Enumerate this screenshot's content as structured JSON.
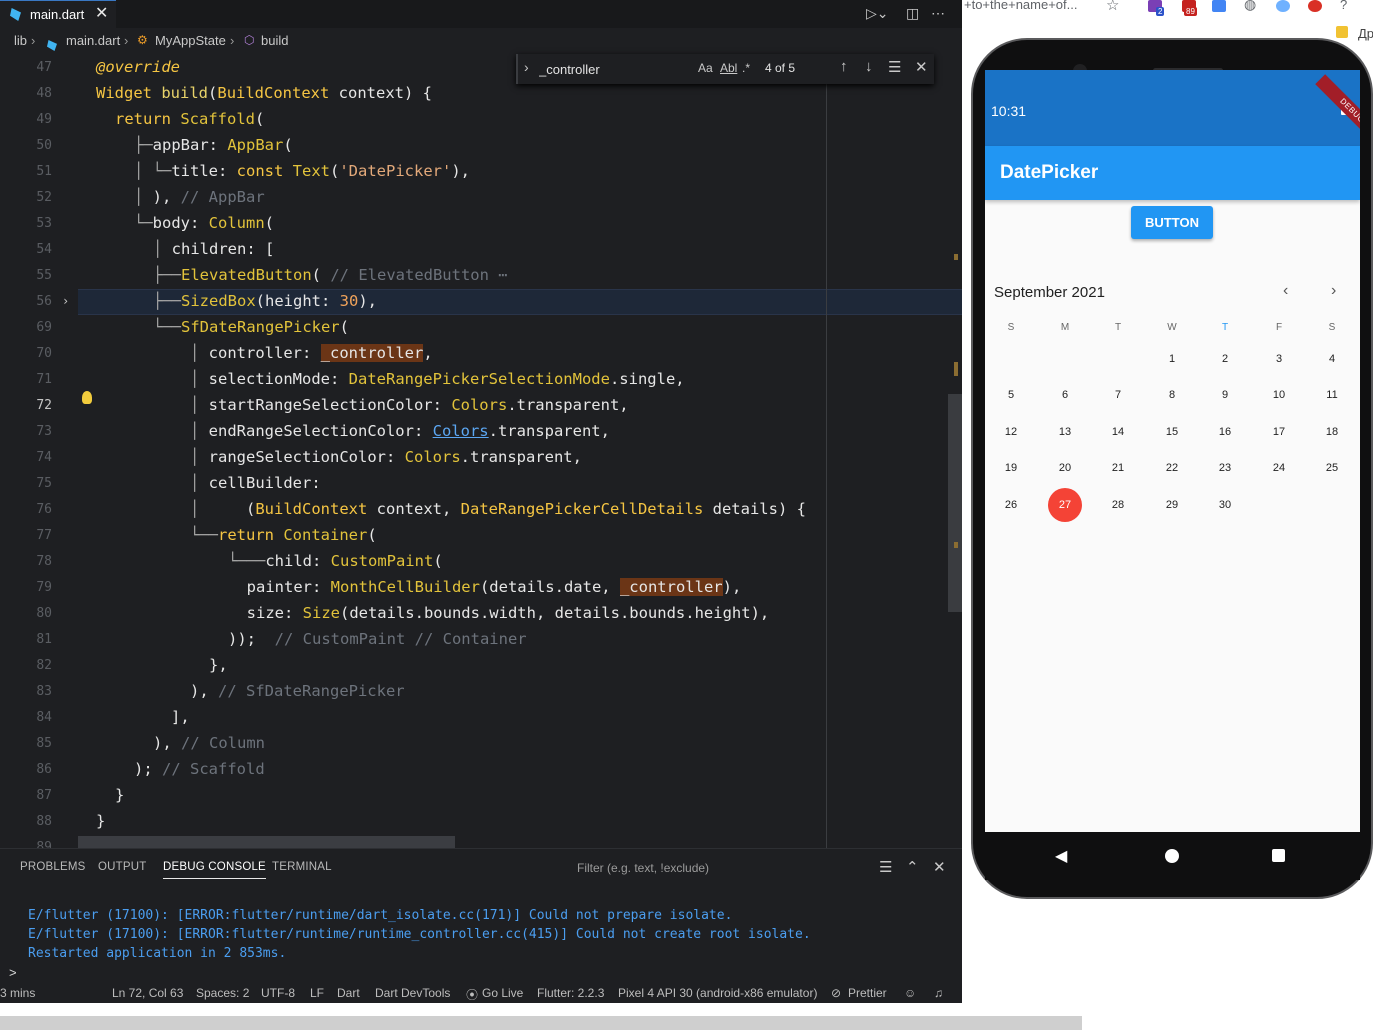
{
  "editor": {
    "tab_title": "main.dart",
    "breadcrumb": {
      "lib": "lib",
      "file": "main.dart",
      "class": "MyAppState",
      "method": "build"
    },
    "find": {
      "query": "_controller",
      "opt_case": "Aa",
      "opt_word": "Abl",
      "opt_regex": ".*",
      "count": "4 of 5"
    },
    "line_numbers": [
      "47",
      "48",
      "49",
      "50",
      "51",
      "52",
      "53",
      "54",
      "55",
      "56",
      "69",
      "70",
      "71",
      "72",
      "73",
      "74",
      "75",
      "76",
      "77",
      "78",
      "79",
      "80",
      "81",
      "82",
      "83",
      "84",
      "85",
      "86",
      "87",
      "88",
      "89"
    ],
    "active_line": "72"
  },
  "panel": {
    "tabs": [
      "PROBLEMS",
      "OUTPUT",
      "DEBUG CONSOLE",
      "TERMINAL"
    ],
    "active_tab": "DEBUG CONSOLE",
    "filter_placeholder": "Filter (e.g. text, !exclude)",
    "console": [
      "E/flutter (17100): [ERROR:flutter/runtime/dart_isolate.cc(171)] Could not prepare isolate.",
      "E/flutter (17100): [ERROR:flutter/runtime/runtime_controller.cc(415)] Could not create root isolate.",
      "Restarted application in 2 853ms."
    ],
    "prompt": ">"
  },
  "statusbar": {
    "elapsed": "3 mins",
    "position": "Ln 72, Col 63",
    "spaces": "Spaces: 2",
    "encoding": "UTF-8",
    "eol": "LF",
    "language": "Dart",
    "devtools": "Dart DevTools",
    "golive": "Go Live",
    "flutter": "Flutter: 2.2.3",
    "device": "Pixel 4 API 30 (android-x86 emulator)",
    "prettier": "Prettier"
  },
  "browser": {
    "url_fragment": "+to+the+name+of...",
    "bookmark_fragment": "Др",
    "badge_2": "2",
    "badge_89": "89"
  },
  "phone": {
    "time": "10:31",
    "app_title": "DatePicker",
    "debug_label": "DEBUG",
    "button_label": "BUTTON",
    "month_label": "September 2021",
    "weekdays": [
      "S",
      "M",
      "T",
      "W",
      "T",
      "F",
      "S"
    ],
    "today_weekday_index": 4,
    "weeks": [
      [
        "",
        "",
        "",
        "1",
        "2",
        "3",
        "4"
      ],
      [
        "5",
        "6",
        "7",
        "8",
        "9",
        "10",
        "11"
      ],
      [
        "12",
        "13",
        "14",
        "15",
        "16",
        "17",
        "18"
      ],
      [
        "19",
        "20",
        "21",
        "22",
        "23",
        "24",
        "25"
      ],
      [
        "26",
        "27",
        "28",
        "29",
        "30",
        "",
        ""
      ]
    ],
    "selected_day": "27"
  },
  "colors": {
    "accent": "#2196f3",
    "selected": "#f44336",
    "status_blue": "#1a73c6",
    "debug_console_text": "#4b9ef0"
  }
}
